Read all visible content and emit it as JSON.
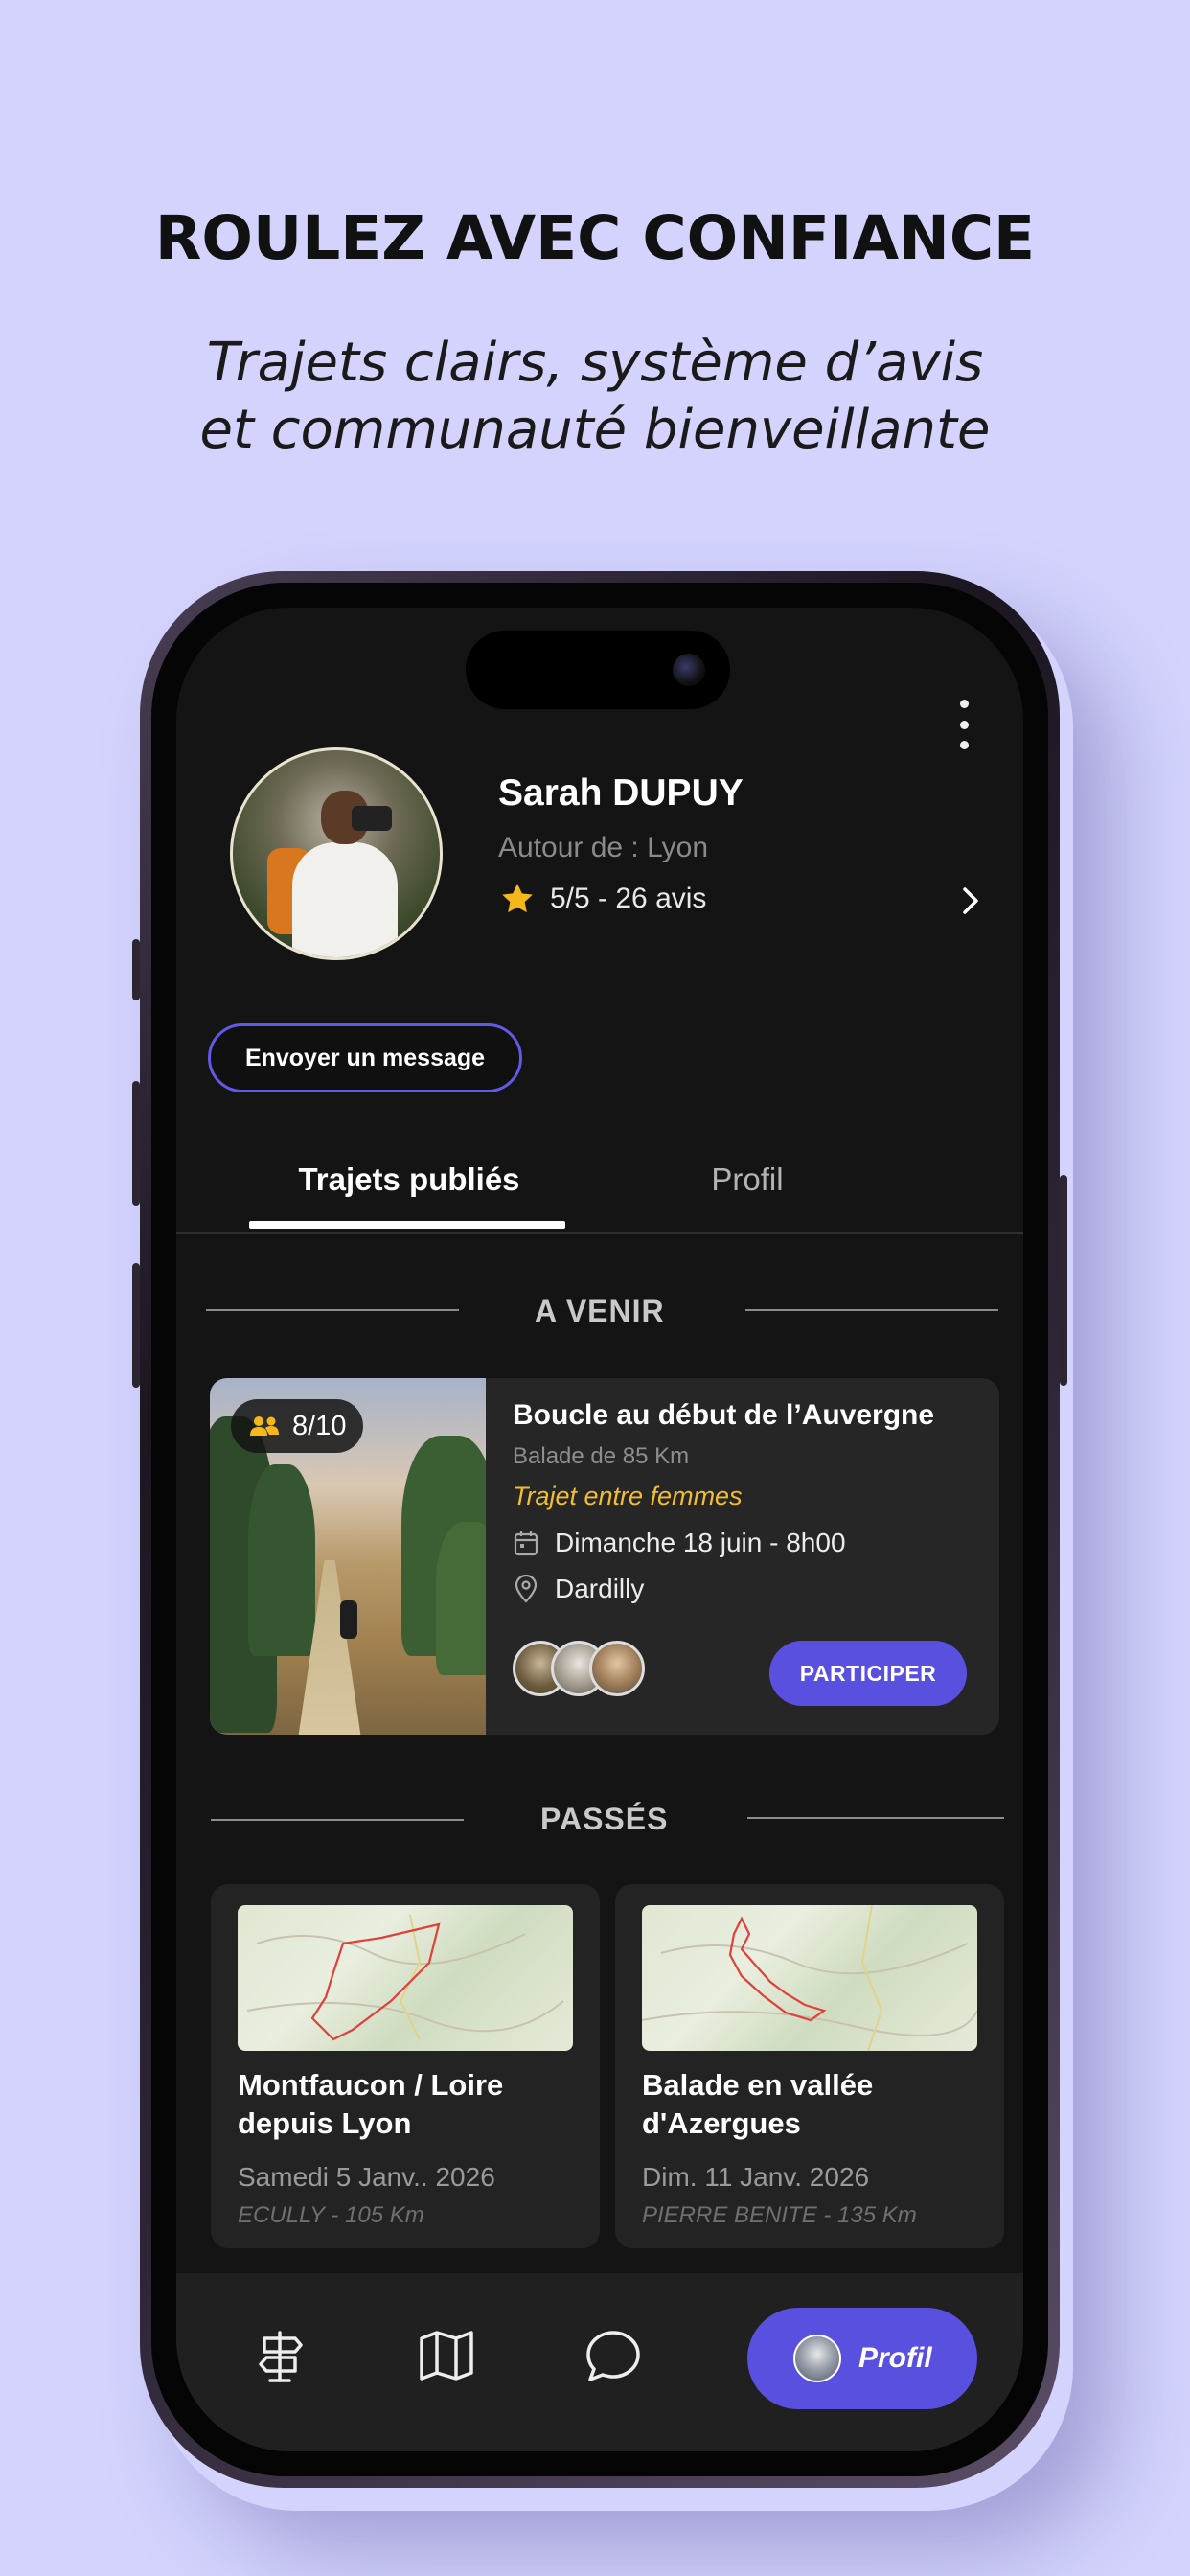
{
  "marketing": {
    "headline": "ROULEZ AVEC CONFIANCE",
    "subline": "Trajets clairs, système d’avis\net communauté bienveillante"
  },
  "profile": {
    "name": "Sarah DUPUY",
    "location": "Autour de : Lyon",
    "rating": "5/5 - 26 avis",
    "message_button": "Envoyer un message"
  },
  "tabs": [
    {
      "label": "Trajets publiés",
      "active": true
    },
    {
      "label": "Profil",
      "active": false
    }
  ],
  "upcoming": {
    "section_title": "A VENIR",
    "trip": {
      "participants_badge": "8/10",
      "title": "Boucle au début de l’Auvergne",
      "subtitle": "Balade de 85 Km",
      "tag": "Trajet entre femmes",
      "date": "Dimanche 18 juin - 8h00",
      "place": "Dardilly",
      "join_button": "PARTICIPER"
    }
  },
  "past": {
    "section_title": "PASSÉS",
    "trips": [
      {
        "title": "Montfaucon / Loire depuis Lyon",
        "date": "Samedi 5 Janv.. 2026",
        "meta": "ECULLY - 105 Km"
      },
      {
        "title": "Balade en vallée d'Azergues",
        "date": "Dim. 11 Janv. 2026",
        "meta": "PIERRE BENITE - 135 Km"
      }
    ]
  },
  "bottom_nav": {
    "items": [
      "signpost-icon",
      "map-icon",
      "chat-icon"
    ],
    "active_label": "Profil"
  },
  "colors": {
    "background": "#d3d3fd",
    "accent": "#5a50e0",
    "tag": "#f2bd2f",
    "screen": "#141414"
  }
}
